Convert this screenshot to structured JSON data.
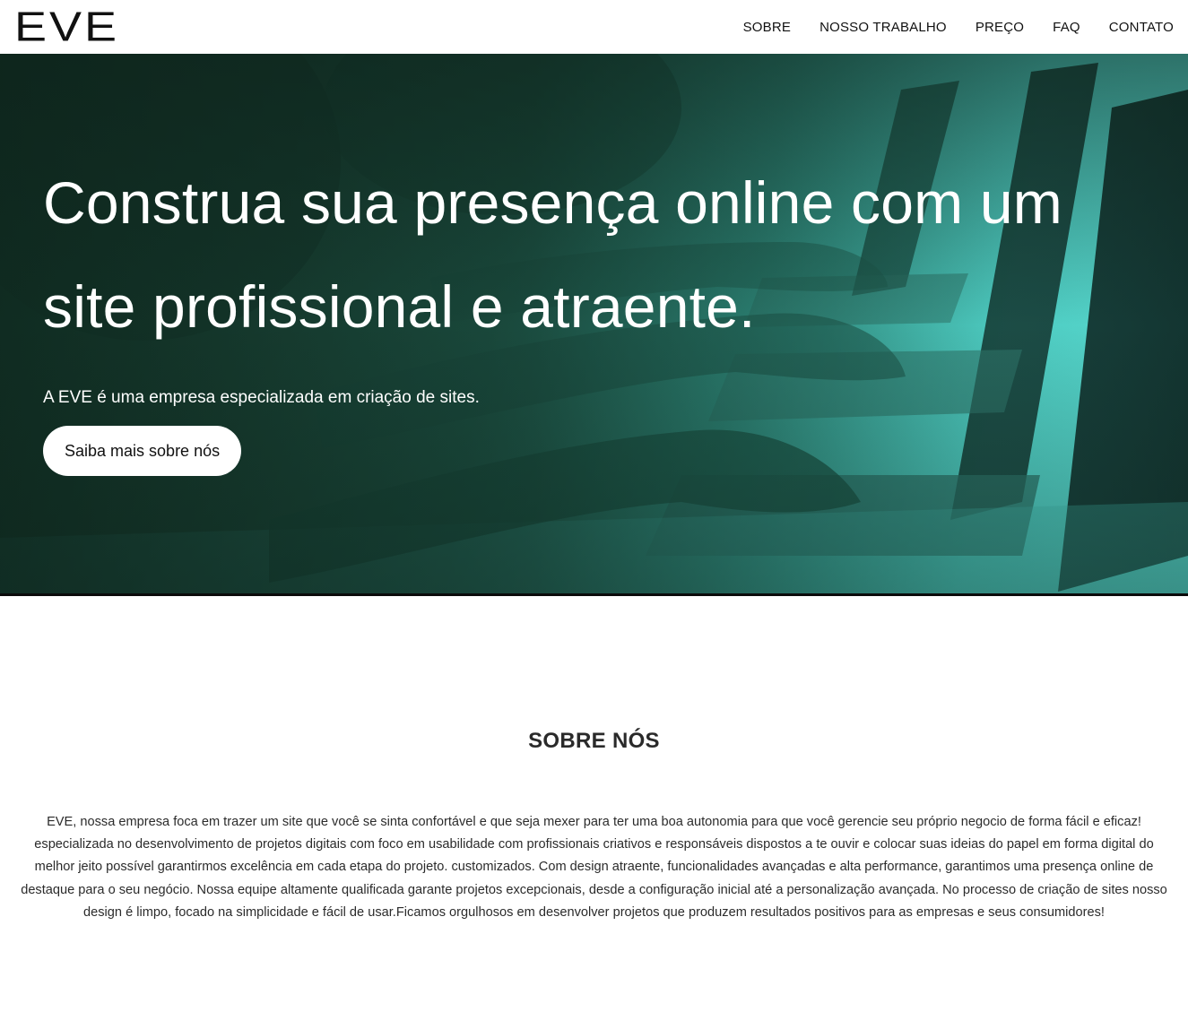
{
  "brand": {
    "logo_text": "EVE"
  },
  "nav": {
    "items": [
      {
        "label": "SOBRE"
      },
      {
        "label": "NOSSO TRABALHO"
      },
      {
        "label": "PREÇO"
      },
      {
        "label": "FAQ"
      },
      {
        "label": "CONTATO"
      }
    ]
  },
  "hero": {
    "title": "Construa sua presença online com um site profissional e atraente.",
    "subtitle": "A EVE é uma empresa especializada em criação de sites.",
    "button_label": "Saiba mais sobre nós",
    "accent_color": "#5ad9cf"
  },
  "about": {
    "title": "SOBRE NÓS",
    "text": "EVE, nossa empresa foca em trazer um site que você se sinta confortável e que seja mexer para ter uma boa autonomia para que você gerencie seu próprio negocio de forma fácil e eficaz! especializada no desenvolvimento de projetos digitais com foco em usabilidade com profissionais criativos e responsáveis dispostos a te ouvir e colocar suas ideias do papel em forma digital do melhor jeito possível garantirmos excelência em cada etapa do projeto. customizados. Com design atraente, funcionalidades avançadas e alta performance, garantimos uma presença online de destaque para o seu negócio. Nossa equipe altamente qualificada garante projetos excepcionais, desde a configuração inicial até a personalização avançada. No processo de criação de sites nosso design é limpo, focado na simplicidade e fácil de usar.Ficamos orgulhosos em desenvolver projetos que produzem resultados positivos para as empresas e seus consumidores!"
  }
}
